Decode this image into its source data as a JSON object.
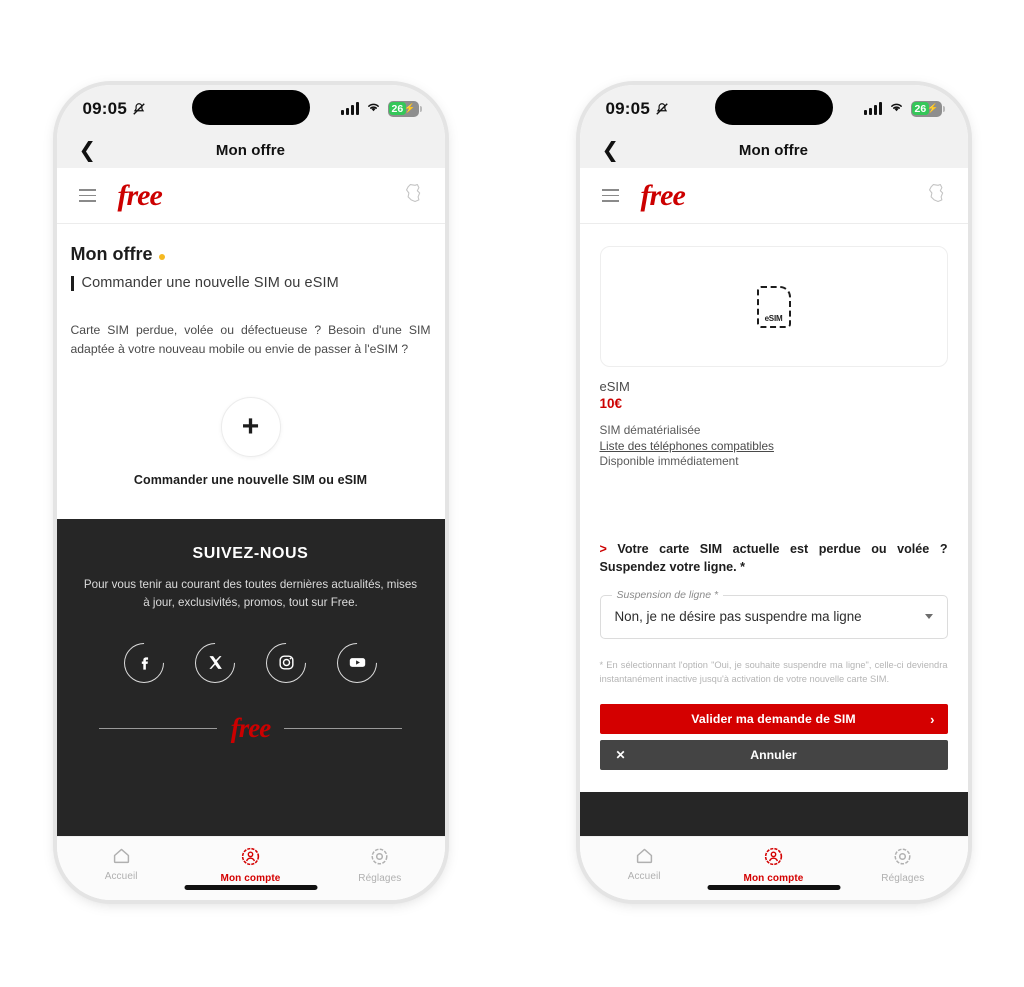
{
  "status_bar": {
    "time": "09:05",
    "silent_icon": "bell-off-icon",
    "signal_icon": "cellular-bars-icon",
    "wifi_icon": "wifi-icon",
    "battery_level": "26",
    "battery_charging": "⚡",
    "battery_color": "#35c759"
  },
  "nav": {
    "back_icon": "chevron-left-icon",
    "title": "Mon offre"
  },
  "app_header": {
    "menu_icon": "hamburger-menu-icon",
    "logo": "free",
    "region_icon": "france-map-icon",
    "brand_red": "#cc0000"
  },
  "screen_one": {
    "heading": "Mon offre",
    "heading_dot_color": "#f5b921",
    "subtitle": "Commander une nouvelle SIM ou eSIM",
    "paragraph": "Carte SIM perdue, volée ou défectueuse ? Besoin d'une SIM adaptée à votre nouveau mobile ou envie de passer à l'eSIM ?",
    "add_icon": "plus-icon",
    "add_label": "Commander une nouvelle SIM ou eSIM"
  },
  "follow_us": {
    "title": "SUIVEZ-NOUS",
    "description": "Pour vous tenir au courant des toutes dernières actualités, mises à jour, exclusivités, promos, tout sur Free.",
    "socials": [
      {
        "name": "facebook-icon",
        "label": "Facebook"
      },
      {
        "name": "x-twitter-icon",
        "label": "X"
      },
      {
        "name": "instagram-icon",
        "label": "Instagram"
      },
      {
        "name": "youtube-icon",
        "label": "YouTube"
      }
    ],
    "logo": "free"
  },
  "screen_two": {
    "card_icon": "esim-card-icon",
    "card_icon_label": "eSIM",
    "product_name": "eSIM",
    "product_price": "10€",
    "price_color": "#cc0000",
    "meta_line_1": "SIM dématérialisée",
    "meta_link": "Liste des téléphones compatibles",
    "meta_line_2": "Disponible immédiatement",
    "question_marker": ">",
    "question": "Votre carte SIM actuelle est perdue ou volée ? Suspendez votre ligne. *",
    "select_label": "Suspension de ligne *",
    "select_value": "Non, je ne désire pas suspendre ma ligne",
    "select_caret": "chevron-down-icon",
    "footnote": "* En sélectionnant l'option \"Oui, je souhaite suspendre ma ligne\", celle-ci deviendra instantanément inactive jusqu'à activation de votre nouvelle carte SIM.",
    "validate_label": "Valider ma demande de SIM",
    "validate_chevron": "›",
    "validate_color": "#d40000",
    "cancel_label": "Annuler",
    "cancel_x": "✕",
    "cancel_color": "#444444"
  },
  "tabbar": {
    "items": [
      {
        "icon": "home-icon",
        "label": "Accueil",
        "active": false
      },
      {
        "icon": "account-icon",
        "label": "Mon compte",
        "active": true
      },
      {
        "icon": "settings-gear-icon",
        "label": "Réglages",
        "active": false
      }
    ],
    "active_color": "#d40000"
  }
}
